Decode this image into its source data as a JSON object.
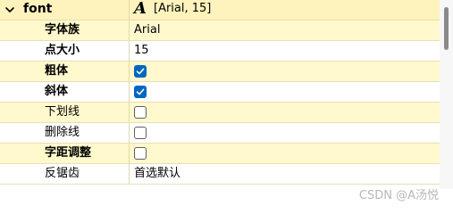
{
  "group": {
    "name": "font",
    "value": "[Arial, 15]",
    "icon": "font-icon"
  },
  "properties": [
    {
      "key": "family",
      "label": "字体族",
      "bold": true,
      "type": "text",
      "value": "Arial"
    },
    {
      "key": "point_size",
      "label": "点大小",
      "bold": true,
      "type": "text",
      "value": "15"
    },
    {
      "key": "bold",
      "label": "粗体",
      "bold": true,
      "type": "checkbox",
      "checked": true
    },
    {
      "key": "italic",
      "label": "斜体",
      "bold": true,
      "type": "checkbox",
      "checked": true
    },
    {
      "key": "underline",
      "label": "下划线",
      "bold": false,
      "type": "checkbox",
      "checked": false
    },
    {
      "key": "strikeout",
      "label": "删除线",
      "bold": false,
      "type": "checkbox",
      "checked": false
    },
    {
      "key": "kerning",
      "label": "字距调整",
      "bold": true,
      "type": "checkbox",
      "checked": false
    },
    {
      "key": "antialiasing",
      "label": "反锯齿",
      "bold": false,
      "type": "text",
      "value": "首选默认"
    }
  ],
  "watermark": "CSDN @A汤悦",
  "colors": {
    "accent": "#0067c0",
    "row_alt": "#fff9cd",
    "row_plain": "#ffffff"
  }
}
